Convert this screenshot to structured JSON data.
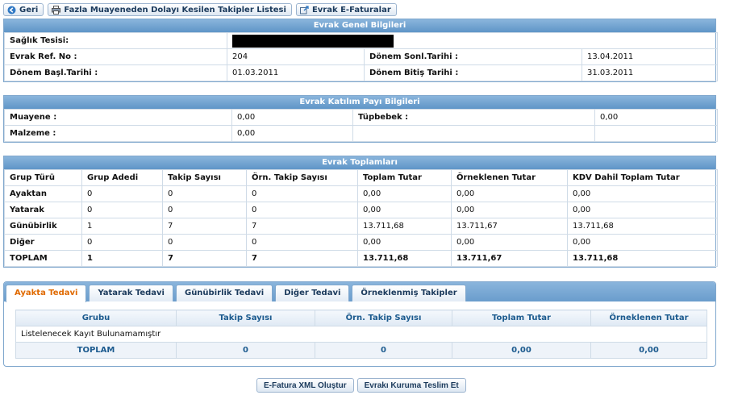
{
  "toolbar": {
    "back_label": "Geri",
    "list_label": "Fazla Muayeneden Dolayı Kesilen Takipler Listesi",
    "efatura_label": "Evrak E-Faturalar"
  },
  "genel": {
    "title": "Evrak Genel Bilgileri",
    "saglik_label": "Sağlık Tesisi:",
    "ref_label": "Evrak Ref. No :",
    "ref_value": "204",
    "sonl_label": "Dönem Sonl.Tarihi :",
    "sonl_value": "13.04.2011",
    "basl_label": "Dönem Başl.Tarihi :",
    "basl_value": "01.03.2011",
    "bitis_label": "Dönem Bitiş Tarihi :",
    "bitis_value": "31.03.2011"
  },
  "katilim": {
    "title": "Evrak Katılım Payı Bilgileri",
    "muayene_label": "Muayene :",
    "muayene_value": "0,00",
    "tupbebek_label": "Tüpbebek :",
    "tupbebek_value": "0,00",
    "malzeme_label": "Malzeme :",
    "malzeme_value": "0,00"
  },
  "toplamlar": {
    "title": "Evrak Toplamları",
    "headers": [
      "Grup Türü",
      "Grup Adedi",
      "Takip Sayısı",
      "Örn. Takip Sayısı",
      "Toplam Tutar",
      "Örneklenen Tutar",
      "KDV Dahil Toplam Tutar"
    ],
    "rows": [
      [
        "Ayaktan",
        "0",
        "0",
        "0",
        "0,00",
        "0,00",
        "0,00"
      ],
      [
        "Yatarak",
        "0",
        "0",
        "0",
        "0,00",
        "0,00",
        "0,00"
      ],
      [
        "Günübirlik",
        "1",
        "7",
        "7",
        "13.711,68",
        "13.711,67",
        "13.711,68"
      ],
      [
        "Diğer",
        "0",
        "0",
        "0",
        "0,00",
        "0,00",
        "0,00"
      ],
      [
        "TOPLAM",
        "1",
        "7",
        "7",
        "13.711,68",
        "13.711,67",
        "13.711,68"
      ]
    ]
  },
  "tabs": [
    "Ayakta Tedavi",
    "Yatarak Tedavi",
    "Günübirlik Tedavi",
    "Diğer Tedavi",
    "Örneklenmiş Takipler"
  ],
  "detail": {
    "headers": [
      "Grubu",
      "Takip Sayısı",
      "Örn. Takip Sayısı",
      "Toplam Tutar",
      "Örneklenen Tutar"
    ],
    "empty_text": "Listelenecek Kayıt Bulunamamıştır",
    "total": [
      "TOPLAM",
      "0",
      "0",
      "0,00",
      "0,00"
    ]
  },
  "actions": {
    "xml_label": "E-Fatura XML Oluştur",
    "teslim_label": "Evrakı Kuruma Teslim Et"
  }
}
